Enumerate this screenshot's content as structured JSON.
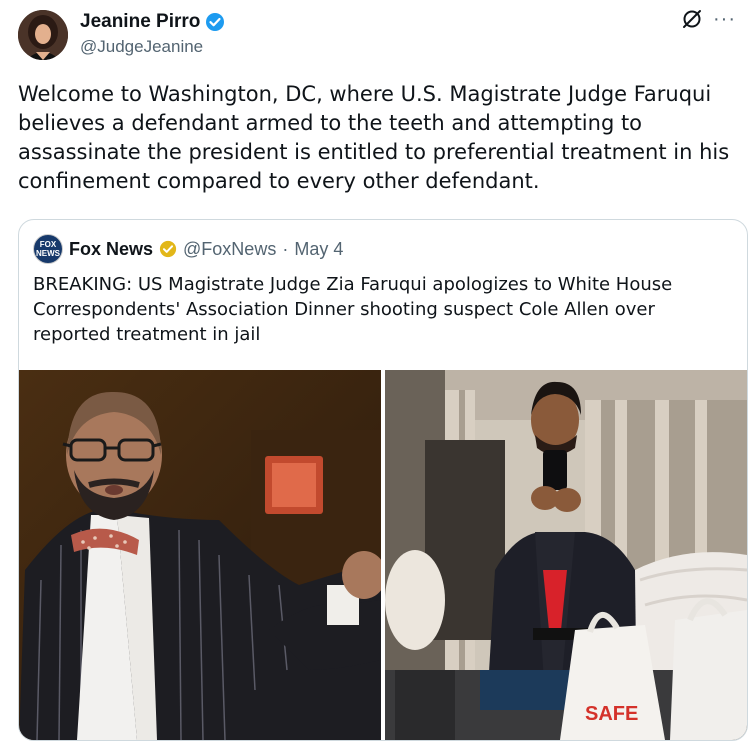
{
  "author": {
    "name": "Jeanine Pirro",
    "handle": "@JudgeJeanine",
    "avatar_icon": "profile-photo",
    "verified_color": "#1d9bf0"
  },
  "tweet": {
    "text": "Welcome to Washington, DC, where U.S. Magistrate Judge Faruqui believes a defendant armed to the teeth and attempting to assassinate the president is entitled to preferential treatment in his confinement compared to every other defendant."
  },
  "top_icons": {
    "grok_icon": "slashed-circle-icon",
    "more_label": "···"
  },
  "quote": {
    "logo_text_line1": "FOX",
    "logo_text_line2": "NEWS",
    "name": "Fox News",
    "handle": "@FoxNews",
    "separator": "·",
    "date": "May 4",
    "text": "BREAKING: US Magistrate Judge Zia Faruqui apologizes to White House Correspondents' Association Dinner shooting suspect Cole Allen over reported treatment in jail",
    "verified_color": "#e2b719"
  },
  "images": {
    "left": "judge-in-courtroom-photo",
    "right": "mirror-selfie-hotel-room-photo",
    "bag_text": "SAFE"
  }
}
